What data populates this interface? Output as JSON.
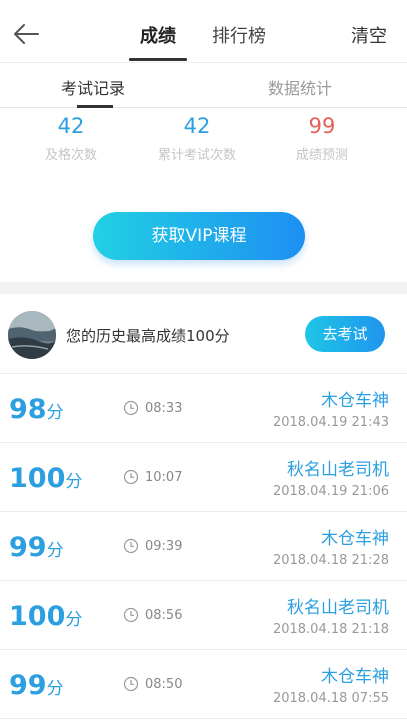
{
  "header": {
    "tabs": [
      {
        "label": "成绩",
        "active": true
      },
      {
        "label": "排行榜",
        "active": false
      }
    ],
    "clear_label": "清空"
  },
  "subtabs": [
    {
      "label": "考试记录",
      "active": true
    },
    {
      "label": "数据统计",
      "active": false
    }
  ],
  "stats": [
    {
      "value": "42",
      "label": "及格次数"
    },
    {
      "value": "42",
      "label": "累计考试次数"
    },
    {
      "value": "99",
      "label": "成绩预测"
    }
  ],
  "vip_button_label": "获取VIP课程",
  "best": {
    "text": "您的历史最高成绩100分",
    "button_label": "去考试"
  },
  "records": [
    {
      "score": "98",
      "unit": "分",
      "duration": "08:33",
      "name": "木仓车神",
      "time": "2018.04.19  21:43"
    },
    {
      "score": "100",
      "unit": "分",
      "duration": "10:07",
      "name": "秋名山老司机",
      "time": "2018.04.19  21:06"
    },
    {
      "score": "99",
      "unit": "分",
      "duration": "09:39",
      "name": "木仓车神",
      "time": "2018.04.18  21:28"
    },
    {
      "score": "100",
      "unit": "分",
      "duration": "08:56",
      "name": "秋名山老司机",
      "time": "2018.04.18  21:18"
    },
    {
      "score": "99",
      "unit": "分",
      "duration": "08:50",
      "name": "木仓车神",
      "time": "2018.04.18  07:55"
    }
  ],
  "colors": {
    "accent_blue": "#2b9fe0",
    "prediction_red": "#e5605a"
  }
}
